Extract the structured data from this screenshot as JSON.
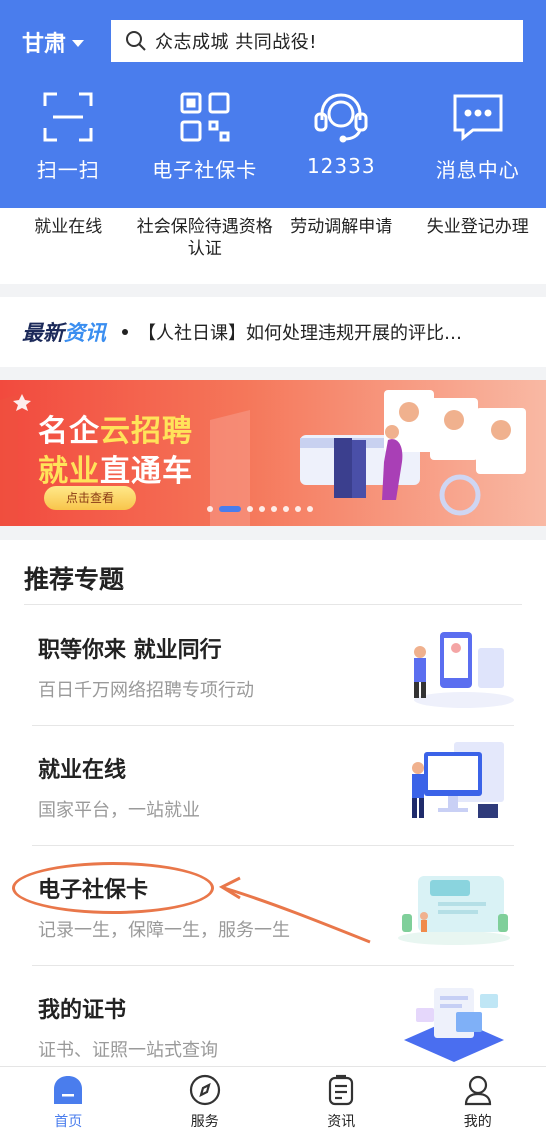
{
  "header": {
    "region": "甘肃",
    "search_placeholder": "众志成城  共同战役!",
    "quick_actions": [
      {
        "label": "扫一扫",
        "icon": "scan-icon"
      },
      {
        "label": "电子社保卡",
        "icon": "qr-code-icon"
      },
      {
        "label": "12333",
        "icon": "headset-icon"
      },
      {
        "label": "消息中心",
        "icon": "message-icon"
      }
    ]
  },
  "services": [
    "就业在线",
    "社会保险待遇资格认证",
    "劳动调解申请",
    "失业登记办理"
  ],
  "news": {
    "tag_part1": "最新",
    "tag_part2": "资讯",
    "headline": "【人社日课】如何处理违规开展的评比…"
  },
  "banner": {
    "line1_a": "名企",
    "line1_b": "云招聘",
    "line2_a": "就业",
    "line2_b": "直通车",
    "button": "点击查看",
    "page_count": 8,
    "active_page": 1
  },
  "topics": {
    "title": "推荐专题",
    "items": [
      {
        "title": "职等你来 就业同行",
        "subtitle": "百日千万网络招聘专项行动"
      },
      {
        "title": "就业在线",
        "subtitle": "国家平台，一站就业"
      },
      {
        "title": "电子社保卡",
        "subtitle": "记录一生，保障一生，服务一生"
      },
      {
        "title": "我的证书",
        "subtitle": "证书、证照一站式查询"
      }
    ]
  },
  "tabbar": [
    {
      "label": "首页",
      "icon": "home-icon",
      "active": true
    },
    {
      "label": "服务",
      "icon": "compass-icon",
      "active": false
    },
    {
      "label": "资讯",
      "icon": "news-icon",
      "active": false
    },
    {
      "label": "我的",
      "icon": "user-icon",
      "active": false
    }
  ],
  "colors": {
    "primary": "#4a7ded",
    "annotation": "#e9774a"
  }
}
